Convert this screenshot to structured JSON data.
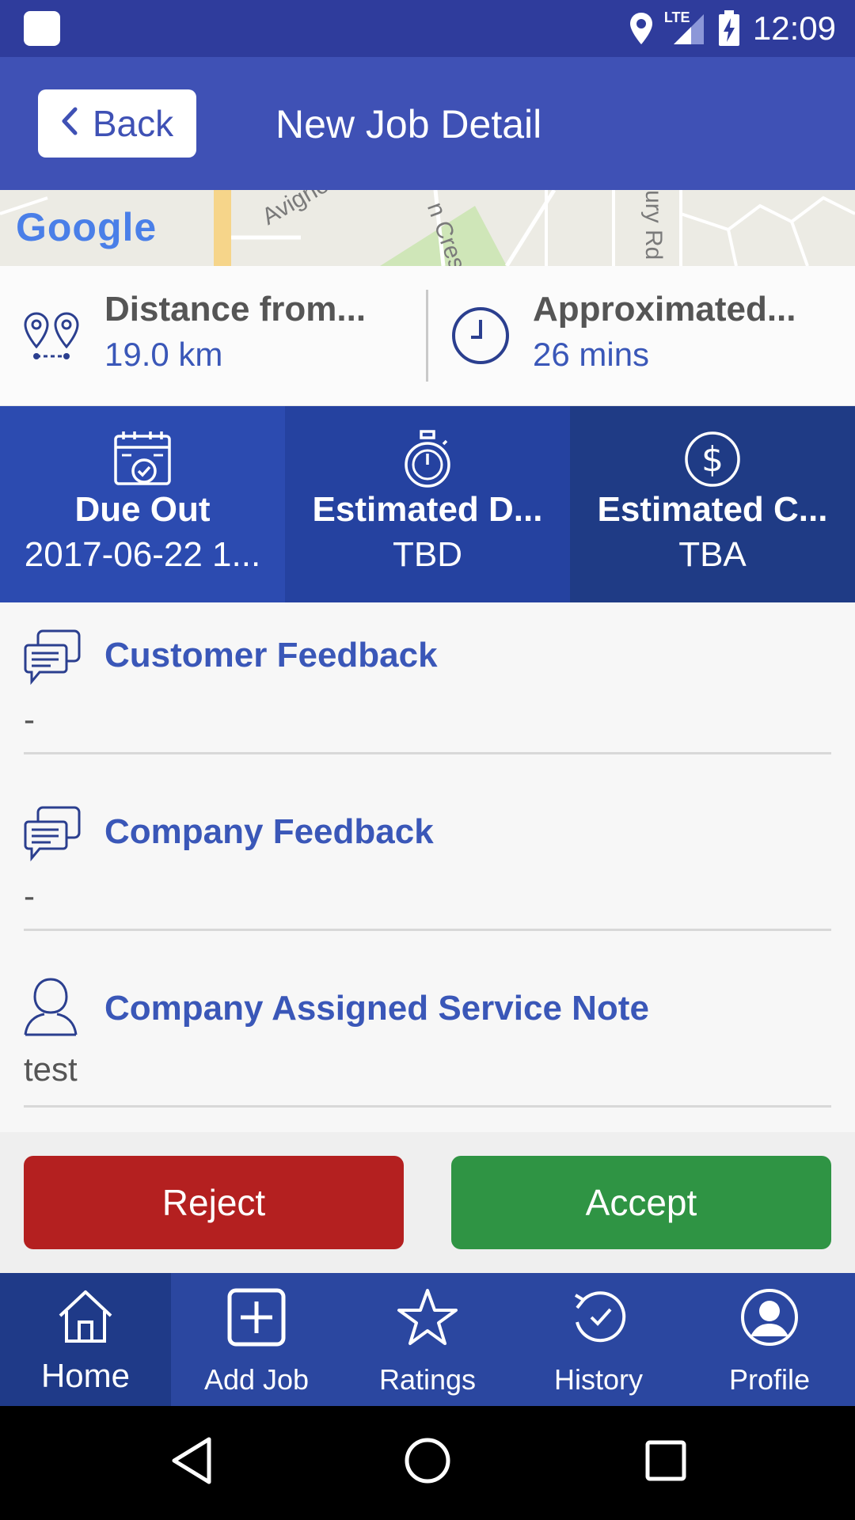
{
  "status_bar": {
    "time": "12:09",
    "network": "LTE"
  },
  "app_bar": {
    "back_label": "Back",
    "title": "New Job Detail"
  },
  "map": {
    "logo": "Google",
    "roads": [
      "Avignon Way",
      "n Cres",
      "ury Rd"
    ]
  },
  "info": {
    "distance": {
      "label": "Distance from...",
      "value": "19.0 km"
    },
    "time": {
      "label": "Approximated...",
      "value": "26 mins"
    }
  },
  "tiles": [
    {
      "title": "Due Out",
      "value": "2017-06-22 1...",
      "icon": "calendar-check-icon",
      "color": "#2c4bb0"
    },
    {
      "title": "Estimated D...",
      "value": "TBD",
      "icon": "stopwatch-icon",
      "color": "#2542a0"
    },
    {
      "title": "Estimated C...",
      "value": "TBA",
      "icon": "dollar-icon",
      "color": "#1f3b85"
    }
  ],
  "sections": [
    {
      "title": "Customer Feedback",
      "value": "-",
      "icon": "chat-icon"
    },
    {
      "title": "Company Feedback",
      "value": "-",
      "icon": "chat-icon"
    },
    {
      "title": "Company Assigned Service Note",
      "value": "test",
      "icon": "user-icon"
    }
  ],
  "actions": {
    "reject": "Reject",
    "accept": "Accept"
  },
  "bottom_nav": [
    {
      "label": "Home",
      "icon": "home-icon",
      "active": true
    },
    {
      "label": "Add Job",
      "icon": "add-icon",
      "active": false
    },
    {
      "label": "Ratings",
      "icon": "star-icon",
      "active": false
    },
    {
      "label": "History",
      "icon": "history-icon",
      "active": false
    },
    {
      "label": "Profile",
      "icon": "profile-icon",
      "active": false
    }
  ],
  "colors": {
    "status_bar": "#2f3c9c",
    "app_bar": "#3f51b5",
    "accent_text": "#3a57b8",
    "reject": "#b42020",
    "accept": "#2f9444",
    "nav": "#2b47a0"
  }
}
